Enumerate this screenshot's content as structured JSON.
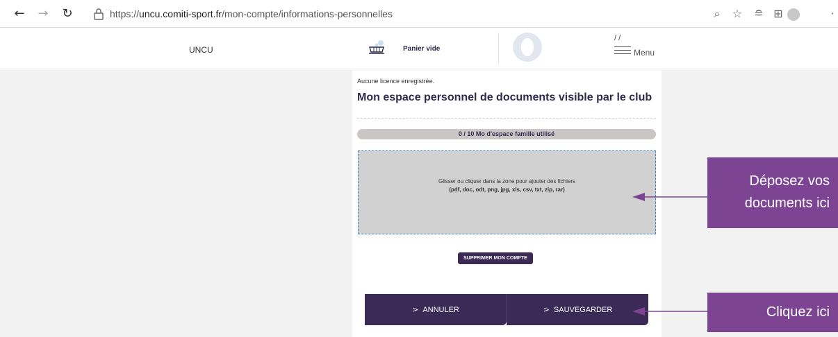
{
  "browser": {
    "url_prefix": "https://",
    "url_host": "uncu.comiti-sport.fr",
    "url_path": "/mon-compte/informations-personnelles",
    "icons": [
      "back-icon",
      "forward-icon",
      "refresh-icon",
      "lock-icon",
      "zoom-icon",
      "star-icon",
      "favorites-icon",
      "collections-icon",
      "profile-icon"
    ]
  },
  "header": {
    "brand": "UNCU",
    "cart_label": "Panier vide",
    "slashes": "/ /",
    "menu_label": "Menu"
  },
  "content": {
    "note": "Aucune licence enregistrée.",
    "title": "Mon espace personnel de documents visible par le club",
    "quota_text": "0 / 10 Mo d'espace famille utilisé",
    "quota_used_fraction": 0,
    "dropzone_line1": "Glisser ou cliquer dans la zone pour ajouter des fichiers",
    "dropzone_line2": "(pdf, doc, odt, png, jpg, xls, csv, txt, zip, rar)",
    "delete_label": "SUPPRIMER MON COMPTE",
    "cancel_label": "ANNULER",
    "save_label": "SAUVEGARDER"
  },
  "callouts": {
    "upload_line1": "Déposez vos",
    "upload_line2": "documents  ici",
    "click": "Cliquez ici"
  },
  "colors": {
    "brand_dark": "#3b2a56",
    "callout": "#7d4494",
    "side_bg": "#f2f2f2"
  }
}
